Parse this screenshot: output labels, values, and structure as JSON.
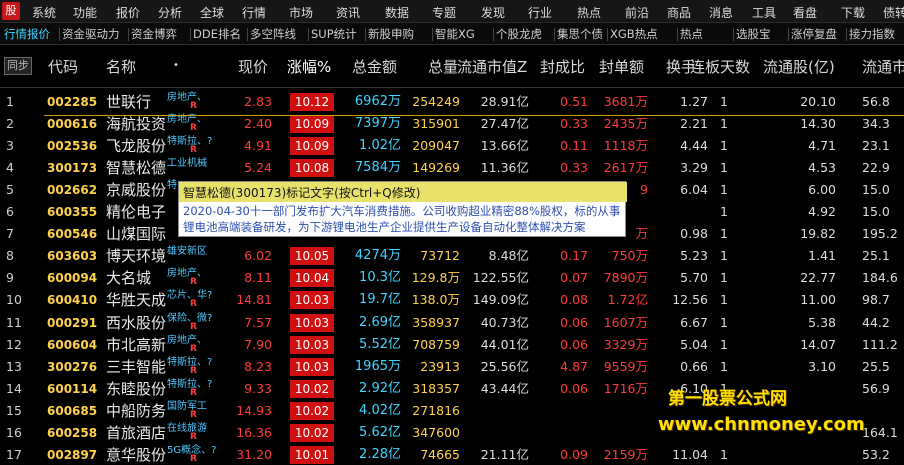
{
  "menu": [
    "系统",
    "功能",
    "报价",
    "分析",
    "全球",
    "行情",
    "市场",
    "资讯",
    "数据",
    "专题",
    "发现",
    "行业",
    "热点",
    "前沿",
    "商品",
    "消息",
    "工具",
    "看盘",
    "下载",
    "债转"
  ],
  "tabs": [
    "行情报价",
    "资金驱动力",
    "资金博弈",
    "DDE排名",
    "多空阵线",
    "SUP统计",
    "新股申购",
    "智能XG",
    "个股龙虎",
    "集思个债",
    "XGB热点",
    "热点",
    "选股宝",
    "涨停复盘",
    "接力指数"
  ],
  "header": {
    "sync": "同步",
    "code": "代码",
    "name": "名称",
    "name_dot": "•",
    "price": "现价",
    "pct": "涨幅%",
    "total_amount": "总金额",
    "total_volume": "总量",
    "market_cap": "流通市值Z",
    "seal_ratio": "封成比",
    "seal_amount": "封单额",
    "turnover": "换手",
    "limit_days": "连板天数",
    "float_shares": "流通股(亿)",
    "float_mcap": "流通市"
  },
  "rows": [
    {
      "n": "1",
      "code": "002285",
      "name": "世联行",
      "tag": "房地产、",
      "r": "R",
      "price": "2.83",
      "pct": "10.12",
      "amt": "6962万",
      "vol": "254249",
      "mcap": "28.91亿",
      "seal": "0.51",
      "sealamt": "3681万",
      "turn": "1.27",
      "days": "1",
      "float": "20.10",
      "float2": "56.8"
    },
    {
      "n": "2",
      "code": "000616",
      "name": "海航投资",
      "tag": "房地产、",
      "r": "R",
      "price": "2.40",
      "pct": "10.09",
      "amt": "7397万",
      "vol": "315901",
      "mcap": "27.47亿",
      "seal": "0.33",
      "sealamt": "2435万",
      "turn": "2.21",
      "days": "1",
      "float": "14.30",
      "float2": "34.3"
    },
    {
      "n": "3",
      "code": "002536",
      "name": "飞龙股份",
      "tag": "特斯拉、?",
      "r": "R",
      "price": "4.91",
      "pct": "10.09",
      "amt": "1.02亿",
      "vol": "209047",
      "mcap": "13.66亿",
      "seal": "0.11",
      "sealamt": "1118万",
      "turn": "4.44",
      "days": "1",
      "float": "4.71",
      "float2": "23.1"
    },
    {
      "n": "4",
      "code": "300173",
      "name": "智慧松德",
      "tag": "工业机械",
      "r": "",
      "price": "5.24",
      "pct": "10.08",
      "amt": "7584万",
      "vol": "149269",
      "mcap": "11.36亿",
      "seal": "0.33",
      "sealamt": "2617万",
      "turn": "3.29",
      "days": "1",
      "float": "4.53",
      "float2": "22.9"
    },
    {
      "n": "5",
      "code": "002662",
      "name": "京威股份",
      "tag": "特",
      "r": "",
      "price": "",
      "pct": "",
      "amt": "",
      "vol": "",
      "mcap": "",
      "seal": "",
      "sealamt": "9",
      "turn": "6.04",
      "days": "1",
      "float": "6.00",
      "float2": "15.0"
    },
    {
      "n": "6",
      "code": "600355",
      "name": "精伦电子",
      "tag": "",
      "r": "",
      "price": "",
      "pct": "",
      "amt": "",
      "vol": "",
      "mcap": "",
      "seal": "",
      "sealamt": "",
      "turn": "",
      "days": "1",
      "float": "4.92",
      "float2": "15.0"
    },
    {
      "n": "7",
      "code": "600546",
      "name": "山煤国际",
      "tag": "",
      "r": "",
      "price": "",
      "pct": "",
      "amt": "",
      "vol": "",
      "mcap": "",
      "seal": "",
      "sealamt": "万",
      "turn": "0.98",
      "days": "1",
      "float": "19.82",
      "float2": "195.2"
    },
    {
      "n": "8",
      "code": "603603",
      "name": "博天环境",
      "tag": "雄安新区",
      "r": "",
      "price": "6.02",
      "pct": "10.05",
      "amt": "4274万",
      "vol": "73712",
      "mcap": "8.48亿",
      "seal": "0.17",
      "sealamt": "750万",
      "turn": "5.23",
      "days": "1",
      "float": "1.41",
      "float2": "25.1"
    },
    {
      "n": "9",
      "code": "600094",
      "name": "大名城",
      "tag": "房地产、",
      "r": "R",
      "price": "8.11",
      "pct": "10.04",
      "amt": "10.3亿",
      "vol": "129.8万",
      "mcap": "122.55亿",
      "seal": "0.07",
      "sealamt": "7890万",
      "turn": "5.70",
      "days": "1",
      "float": "22.77",
      "float2": "184.6"
    },
    {
      "n": "10",
      "code": "600410",
      "name": "华胜天成",
      "tag": "芯片、华?",
      "r": "R",
      "price": "14.81",
      "pct": "10.03",
      "amt": "19.7亿",
      "vol": "138.0万",
      "mcap": "149.09亿",
      "seal": "0.08",
      "sealamt": "1.72亿",
      "turn": "12.56",
      "days": "1",
      "float": "11.00",
      "float2": "98.7"
    },
    {
      "n": "11",
      "code": "000291",
      "name": "西水股份",
      "tag": "保险、微?",
      "r": "R",
      "price": "7.57",
      "pct": "10.03",
      "amt": "2.69亿",
      "vol": "358937",
      "mcap": "40.73亿",
      "seal": "0.06",
      "sealamt": "1607万",
      "turn": "6.67",
      "days": "1",
      "float": "5.38",
      "float2": "44.2"
    },
    {
      "n": "12",
      "code": "600604",
      "name": "市北高新",
      "tag": "房地产、",
      "r": "R",
      "price": "7.90",
      "pct": "10.03",
      "amt": "5.52亿",
      "vol": "708759",
      "mcap": "44.01亿",
      "seal": "0.06",
      "sealamt": "3329万",
      "turn": "5.04",
      "days": "1",
      "float": "14.07",
      "float2": "111.2"
    },
    {
      "n": "13",
      "code": "300276",
      "name": "三丰智能",
      "tag": "特斯拉、?",
      "r": "R",
      "price": "8.23",
      "pct": "10.03",
      "amt": "1965万",
      "vol": "23913",
      "mcap": "25.56亿",
      "seal": "4.87",
      "sealamt": "9559万",
      "turn": "0.66",
      "days": "1",
      "float": "3.10",
      "float2": "25.5"
    },
    {
      "n": "14",
      "code": "600114",
      "name": "东睦股份",
      "tag": "特斯拉、?",
      "r": "R",
      "price": "9.33",
      "pct": "10.02",
      "amt": "2.92亿",
      "vol": "318357",
      "mcap": "43.44亿",
      "seal": "0.06",
      "sealamt": "1716万",
      "turn": "6.10",
      "days": "1",
      "float": "",
      "float2": "56.9"
    },
    {
      "n": "15",
      "code": "600685",
      "name": "中船防务",
      "tag": "国防军工",
      "r": "R",
      "price": "14.93",
      "pct": "10.02",
      "amt": "4.02亿",
      "vol": "271816",
      "mcap": "",
      "seal": "",
      "sealamt": "",
      "turn": "",
      "days": "",
      "float": "",
      "float2": ""
    },
    {
      "n": "16",
      "code": "600258",
      "name": "首旅酒店",
      "tag": "在线旅游",
      "r": "R",
      "price": "16.36",
      "pct": "10.02",
      "amt": "5.62亿",
      "vol": "347600",
      "mcap": "",
      "seal": "",
      "sealamt": "",
      "turn": "",
      "days": "",
      "float": "",
      "float2": "164.1"
    },
    {
      "n": "17",
      "code": "002897",
      "name": "意华股份",
      "tag": "5G概念、?",
      "r": "R",
      "price": "31.20",
      "pct": "10.01",
      "amt": "2.28亿",
      "vol": "74665",
      "mcap": "21.11亿",
      "seal": "0.09",
      "sealamt": "2159万",
      "turn": "11.04",
      "days": "1",
      "float": "",
      "float2": "53.2"
    }
  ],
  "tooltip": {
    "title": "智慧松德(300173)标记文字(按Ctrl+Q修改)",
    "body": "2020-04-30十一部门发布扩大汽车消费措施。公司收购超业精密88%股权，标的从事锂电池高端装备研发，为下游锂电池生产企业提供生产设备自动化整体解决方案"
  },
  "watermark": {
    "line1": "第一股票公式网",
    "line2": "www.chnmoney.com"
  }
}
